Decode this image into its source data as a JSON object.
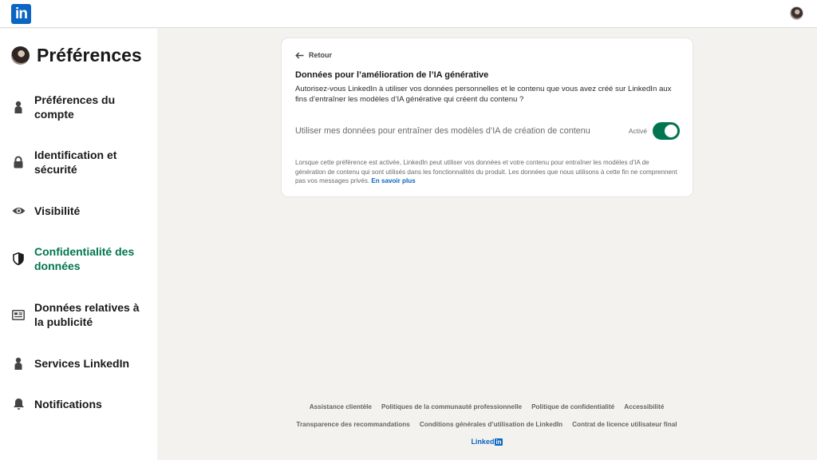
{
  "topbar": {
    "logo_text": "in"
  },
  "sidebar": {
    "title": "Préférences",
    "items": [
      {
        "label": "Préférences du compte",
        "icon": "person-icon"
      },
      {
        "label": "Identification et sécurité",
        "icon": "lock-icon"
      },
      {
        "label": "Visibilité",
        "icon": "eye-icon"
      },
      {
        "label": "Confidentialité des données",
        "icon": "shield-icon",
        "active": true
      },
      {
        "label": "Données relatives à la publicité",
        "icon": "newspaper-icon"
      },
      {
        "label": "Services LinkedIn",
        "icon": "person-icon"
      },
      {
        "label": "Notifications",
        "icon": "bell-icon"
      }
    ]
  },
  "card": {
    "back_label": "Retour",
    "title": "Données pour l’amélioration de l’IA générative",
    "description": "Autorisez-vous LinkedIn à utiliser vos données personnelles et le contenu que vous avez créé sur LinkedIn aux fins d’entraîner les modèles d’IA générative qui créent du contenu ?",
    "setting_label": "Utiliser mes données pour entraîner des modèles d’IA de création de contenu",
    "setting_state": "Activé",
    "toggle_on": true,
    "note": "Lorsque cette préférence est activée, LinkedIn peut utiliser vos données et votre contenu pour entraîner les modèles d’IA de génération de contenu qui sont utilisés dans les fonctionnalités du produit. Les données que nous utilisons à cette fin ne comprennent pas vos messages privés.",
    "note_link": "En savoir plus"
  },
  "footer": {
    "row1": [
      "Assistance clientèle",
      "Politiques de la communauté professionnelle",
      "Politique de confidentialité",
      "Accessibilité"
    ],
    "row2": [
      "Transparence des recommandations",
      "Conditions générales d’utilisation de LinkedIn",
      "Contrat de licence utilisateur final"
    ],
    "brand_text": "Linked",
    "brand_box": "in"
  },
  "colors": {
    "accent_green": "#01754f",
    "brand_blue": "#0a66c2",
    "background": "#f4f2ee"
  }
}
